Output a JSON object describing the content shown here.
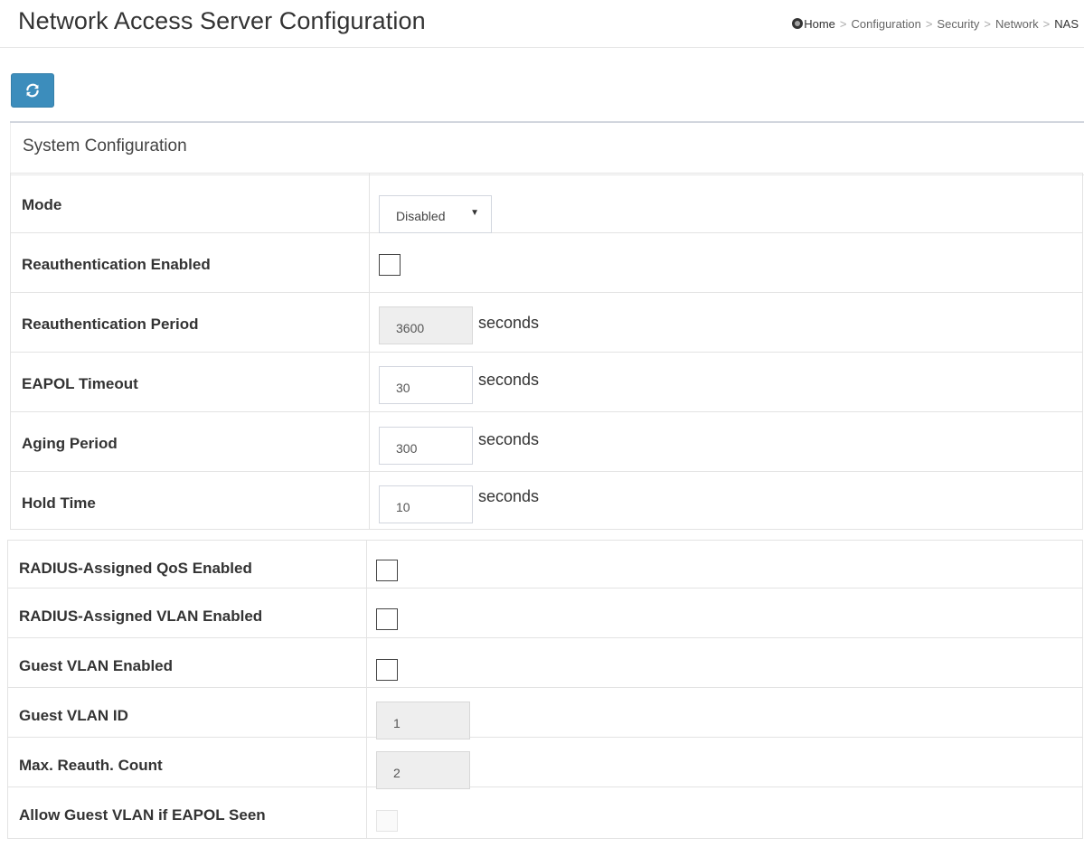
{
  "header": {
    "title": "Network Access Server Configuration",
    "breadcrumb": [
      "Home",
      "Configuration",
      "Security",
      "Network",
      "NAS"
    ],
    "breadcrumb_separator": ">"
  },
  "toolbar": {
    "refresh_icon": "refresh-icon"
  },
  "panel": {
    "title": "System Configuration"
  },
  "rows": {
    "mode": {
      "label": "Mode",
      "value": "Disabled"
    },
    "reauth_enabled": {
      "label": "Reauthentication Enabled",
      "checked": false
    },
    "reauth_period": {
      "label": "Reauthentication Period",
      "value": "3600",
      "unit": "seconds",
      "disabled": true
    },
    "eapol_timeout": {
      "label": "EAPOL Timeout",
      "value": "30",
      "unit": "seconds"
    },
    "aging_period": {
      "label": "Aging Period",
      "value": "300",
      "unit": "seconds"
    },
    "hold_time": {
      "label": "Hold Time",
      "value": "10",
      "unit": "seconds"
    },
    "radius_qos": {
      "label": "RADIUS-Assigned QoS Enabled",
      "checked": false
    },
    "radius_vlan": {
      "label": "RADIUS-Assigned VLAN Enabled",
      "checked": false
    },
    "guest_vlan_enabled": {
      "label": "Guest VLAN Enabled",
      "checked": false
    },
    "guest_vlan_id": {
      "label": "Guest VLAN ID",
      "value": "1",
      "disabled": true
    },
    "max_reauth": {
      "label": "Max. Reauth. Count",
      "value": "2",
      "disabled": true
    },
    "allow_guest_eapol": {
      "label": "Allow Guest VLAN if EAPOL Seen",
      "checked": false,
      "disabled": true
    }
  },
  "colors": {
    "accent": "#3c8dbc",
    "disabled_input": "#eeeeee"
  }
}
